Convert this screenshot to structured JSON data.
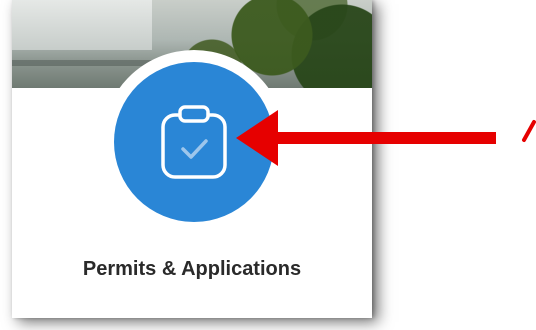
{
  "card": {
    "label": "Permits & Applications",
    "icon": "clipboard-check-icon"
  },
  "annotation": {
    "type": "arrow",
    "color": "#e60000"
  },
  "colors": {
    "icon_bg": "#2a86d6",
    "label_text": "#2a2a2a"
  }
}
